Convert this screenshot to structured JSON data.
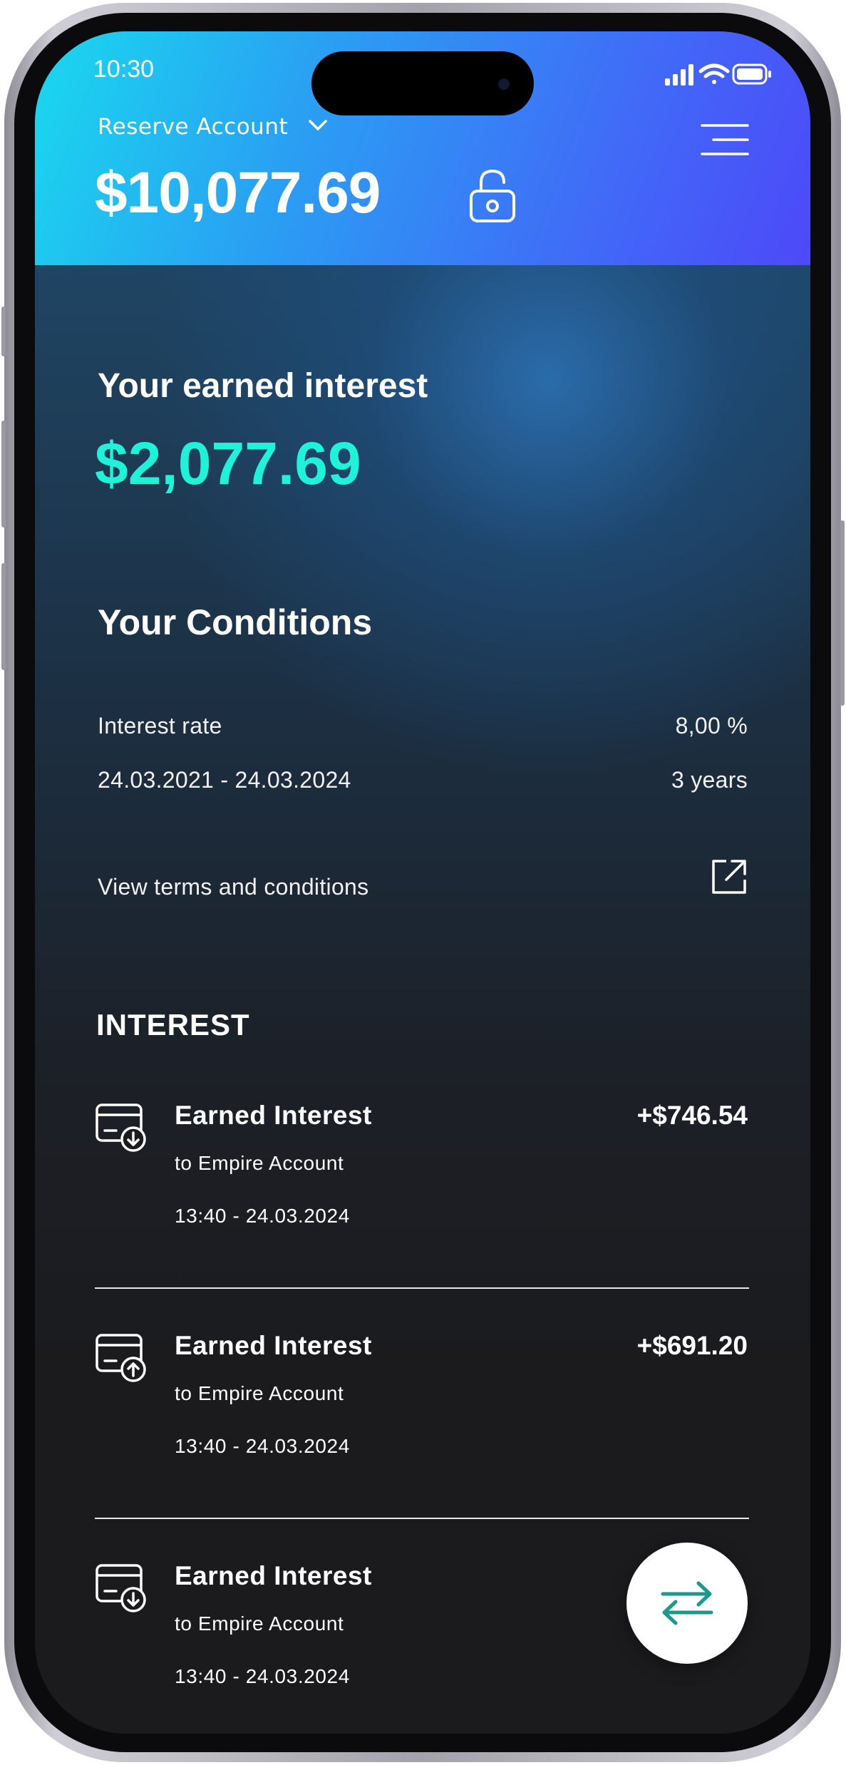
{
  "status_bar": {
    "time": "10:30"
  },
  "header": {
    "account_label": "Reserve Account",
    "balance": "$10,077.69"
  },
  "earned": {
    "title": "Your earned interest",
    "amount": "$2,077.69"
  },
  "conditions": {
    "title": "Your Conditions",
    "interest_rate_label": "Interest rate",
    "interest_rate_value": "8,00 %",
    "period_label": "24.03.2021 - 24.03.2024",
    "period_value": "3 years",
    "terms_link": "View terms and conditions"
  },
  "interest_section": {
    "heading": "INTEREST",
    "transactions": [
      {
        "title": "Earned Interest",
        "subtitle": "to Empire Account",
        "timestamp": "13:40 - 24.03.2024",
        "amount": "+$746.54",
        "icon": "card-download-icon"
      },
      {
        "title": "Earned Interest",
        "subtitle": "to Empire Account",
        "timestamp": "13:40 - 24.03.2024",
        "amount": "+$691.20",
        "icon": "card-upload-icon"
      },
      {
        "title": "Earned Interest",
        "subtitle": "to Empire Account",
        "timestamp": "13:40 - 24.03.2024",
        "amount": "+",
        "icon": "card-download-icon"
      }
    ]
  },
  "colors": {
    "header_gradient_start": "#19d9ee",
    "header_gradient_end": "#4d49f8",
    "accent_amount": "#1ef2d8",
    "fab_icon": "#1a9a8a",
    "background": "#1b1b1e"
  }
}
